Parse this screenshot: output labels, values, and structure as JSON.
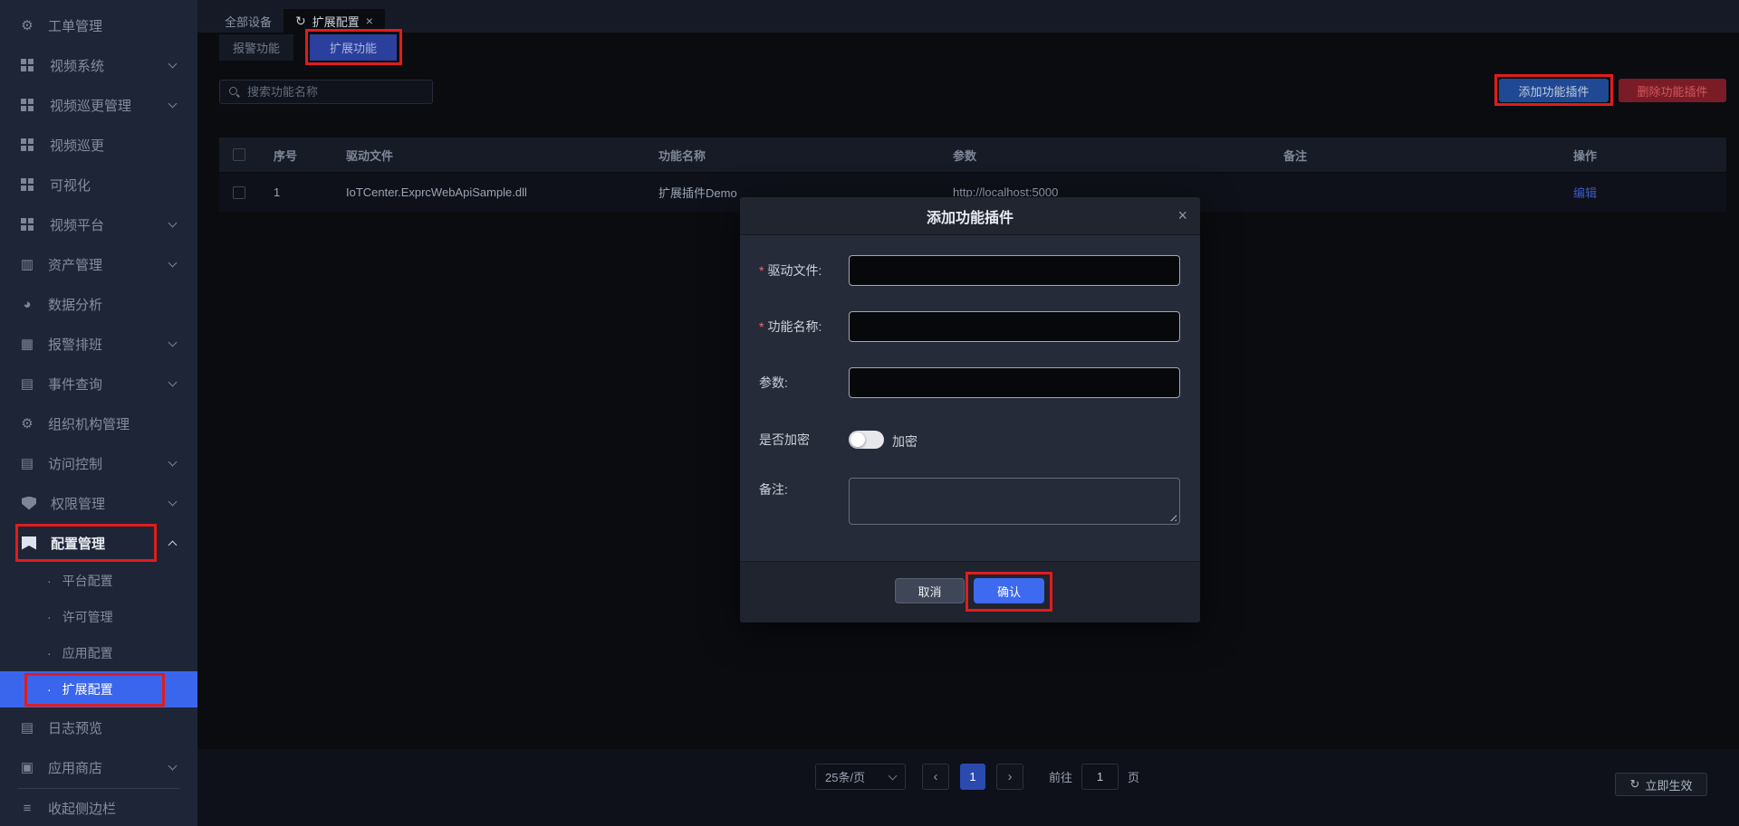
{
  "sidebar": {
    "items": [
      {
        "label": "工单管理"
      },
      {
        "label": "视频系统"
      },
      {
        "label": "视频巡更管理"
      },
      {
        "label": "视频巡更"
      },
      {
        "label": "可视化"
      },
      {
        "label": "视频平台"
      },
      {
        "label": "资产管理"
      },
      {
        "label": "数据分析"
      },
      {
        "label": "报警排班"
      },
      {
        "label": "事件查询"
      },
      {
        "label": "组织机构管理"
      },
      {
        "label": "访问控制"
      },
      {
        "label": "权限管理"
      },
      {
        "label": "配置管理"
      }
    ],
    "config_children": [
      {
        "label": "平台配置"
      },
      {
        "label": "许可管理"
      },
      {
        "label": "应用配置"
      },
      {
        "label": "扩展配置"
      }
    ],
    "bottom_items": [
      {
        "label": "日志预览"
      },
      {
        "label": "应用商店"
      }
    ],
    "collapse_label": "收起侧边栏",
    "bullet": "·"
  },
  "tabs": {
    "device_tab": "全部设备",
    "active_tab": "扩展配置",
    "refresh_icon": "↻",
    "close_icon": "×"
  },
  "subtabs": {
    "alarm": "报警功能",
    "extension": "扩展功能"
  },
  "toolbar": {
    "search_placeholder": "搜索功能名称",
    "add_button": "添加功能插件",
    "delete_button": "删除功能插件"
  },
  "table": {
    "columns": [
      "序号",
      "驱动文件",
      "功能名称",
      "参数",
      "备注",
      "操作"
    ],
    "rows": [
      {
        "no": "1",
        "driver": "IoTCenter.ExprcWebApiSample.dll",
        "name": "扩展插件Demo",
        "param": "http://localhost:5000",
        "remark": "",
        "action": "编辑"
      }
    ]
  },
  "modal": {
    "title": "添加功能插件",
    "close_icon": "×",
    "required_mark": "*",
    "driver_label": "驱动文件:",
    "name_label": "功能名称:",
    "param_label": "参数:",
    "encrypt_label": "是否加密",
    "encrypt_switch_label": "加密",
    "remark_label": "备注:",
    "cancel_button": "取消",
    "confirm_button": "确认"
  },
  "pagination": {
    "page_size": "25条/页",
    "prev_icon": "‹",
    "current_page": "1",
    "next_icon": "›",
    "goto_label": "前往",
    "goto_value": "1",
    "goto_unit": "页"
  },
  "footer": {
    "apply_button": "立即生效",
    "refresh_icon": "↻"
  },
  "colors": {
    "accent_blue": "#3e6af0",
    "sidebar_active": "#3a66ee",
    "subtab_active": "#2b3f9d",
    "add_button_bg": "#1f4994",
    "delete_button_bg": "#7a1c26",
    "annotation_red": "#e11c1c",
    "pagination_active_bg": "#2a4ab0",
    "edit_link": "#3f58c8"
  }
}
